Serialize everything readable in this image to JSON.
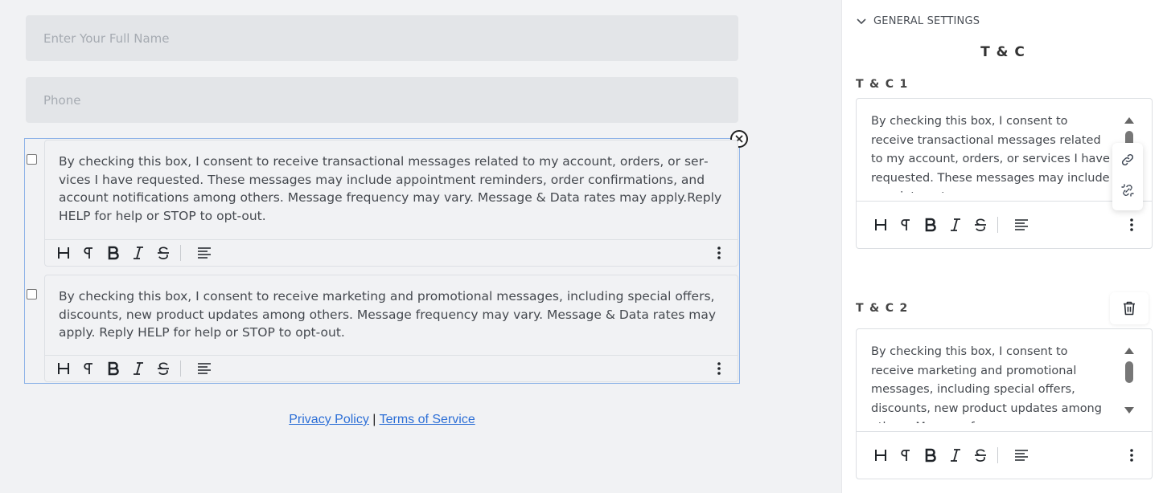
{
  "form": {
    "name_placeholder": "Enter Your Full Name",
    "phone_placeholder": "Phone"
  },
  "consents": [
    {
      "text": "By checking this box, I consent to receive transactional messages related to my account, orders, or ser­vices I have requested. These messages may include appointment reminders, order confirmations, and account notifications among others. Message frequency may vary. Message & Data rates may apply.Reply  HELP for help or STOP to opt-out.",
      "checked": false
    },
    {
      "text": "By checking this box, I consent to receive marketing and promotional messages, including special offers, discounts, new product updates among others. Message frequency may vary. Message & Data rates may apply. Reply HELP for help or STOP to opt-out.",
      "checked": false
    }
  ],
  "toolbar_icons": [
    "heading-icon",
    "paragraph-icon",
    "bold-icon",
    "italic-icon",
    "strikethrough-icon",
    "align-left-icon",
    "more-vertical-icon"
  ],
  "footer": {
    "privacy": "Privacy Policy",
    "separator": "|",
    "terms": "Terms of Service"
  },
  "panel": {
    "section_header": "GENERAL SETTINGS",
    "title": "T & C",
    "tc1": {
      "label": "T & C 1",
      "text": "By checking this box, I consent to receive transactional messages related to my ac­count, orders, or services I have requested. These messages may include appointment"
    },
    "tc2": {
      "label": "T & C 2",
      "text": "By checking this box, I consent to receive marketing and promotional messages, in­cluding special offers, discounts, new prod­uct updates among others. Message fre­"
    }
  },
  "colors": {
    "accent_border": "#8fb4e8",
    "link": "#2d6fd6",
    "field_bg": "#e3e5e8",
    "canvas_bg": "#f1f2f4"
  }
}
